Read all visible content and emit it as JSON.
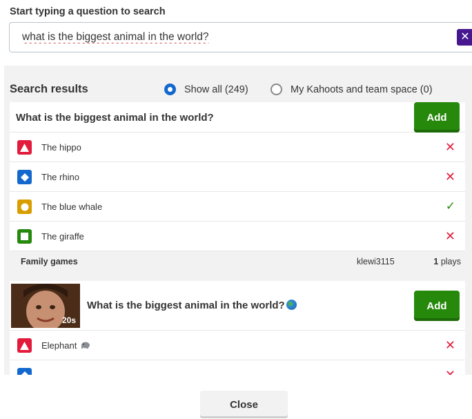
{
  "search": {
    "prompt": "Start typing a question to search",
    "value": "what is the biggest animal in the world?",
    "clear_glyph": "✕"
  },
  "results": {
    "header": "Search results",
    "filters": [
      {
        "label": "Show all (249)",
        "selected": true
      },
      {
        "label": "My Kahoots and team space (0)",
        "selected": false
      }
    ]
  },
  "cards": [
    {
      "question": "What is the biggest animal in the world?",
      "add_label": "Add",
      "answers": [
        {
          "text": "The hippo",
          "shape": "triangle",
          "color": "#e21b3c",
          "correct": false
        },
        {
          "text": "The rhino",
          "shape": "diamond",
          "color": "#1368ce",
          "correct": false
        },
        {
          "text": "The blue whale",
          "shape": "circle",
          "color": "#d89e00",
          "correct": true
        },
        {
          "text": "The giraffe",
          "shape": "square",
          "color": "#26890c",
          "correct": false
        }
      ],
      "footer": {
        "category": "Family games",
        "user": "klewi3115",
        "plays_count": "1",
        "plays_label": "plays"
      }
    },
    {
      "question": "What is the biggest animal in the world?",
      "time": "20s",
      "add_label": "Add",
      "answers": [
        {
          "text": "Elephant",
          "shape": "triangle",
          "color": "#e21b3c",
          "correct": false,
          "icon": "elephant-emoji-icon"
        },
        {
          "text": "",
          "shape": "diamond",
          "color": "#1368ce",
          "correct": false
        }
      ]
    }
  ],
  "marks": {
    "wrong": "✕",
    "right": "✓"
  },
  "close_label": "Close",
  "colors": {
    "brand_purple": "#46178f",
    "add_green": "#26890c"
  }
}
